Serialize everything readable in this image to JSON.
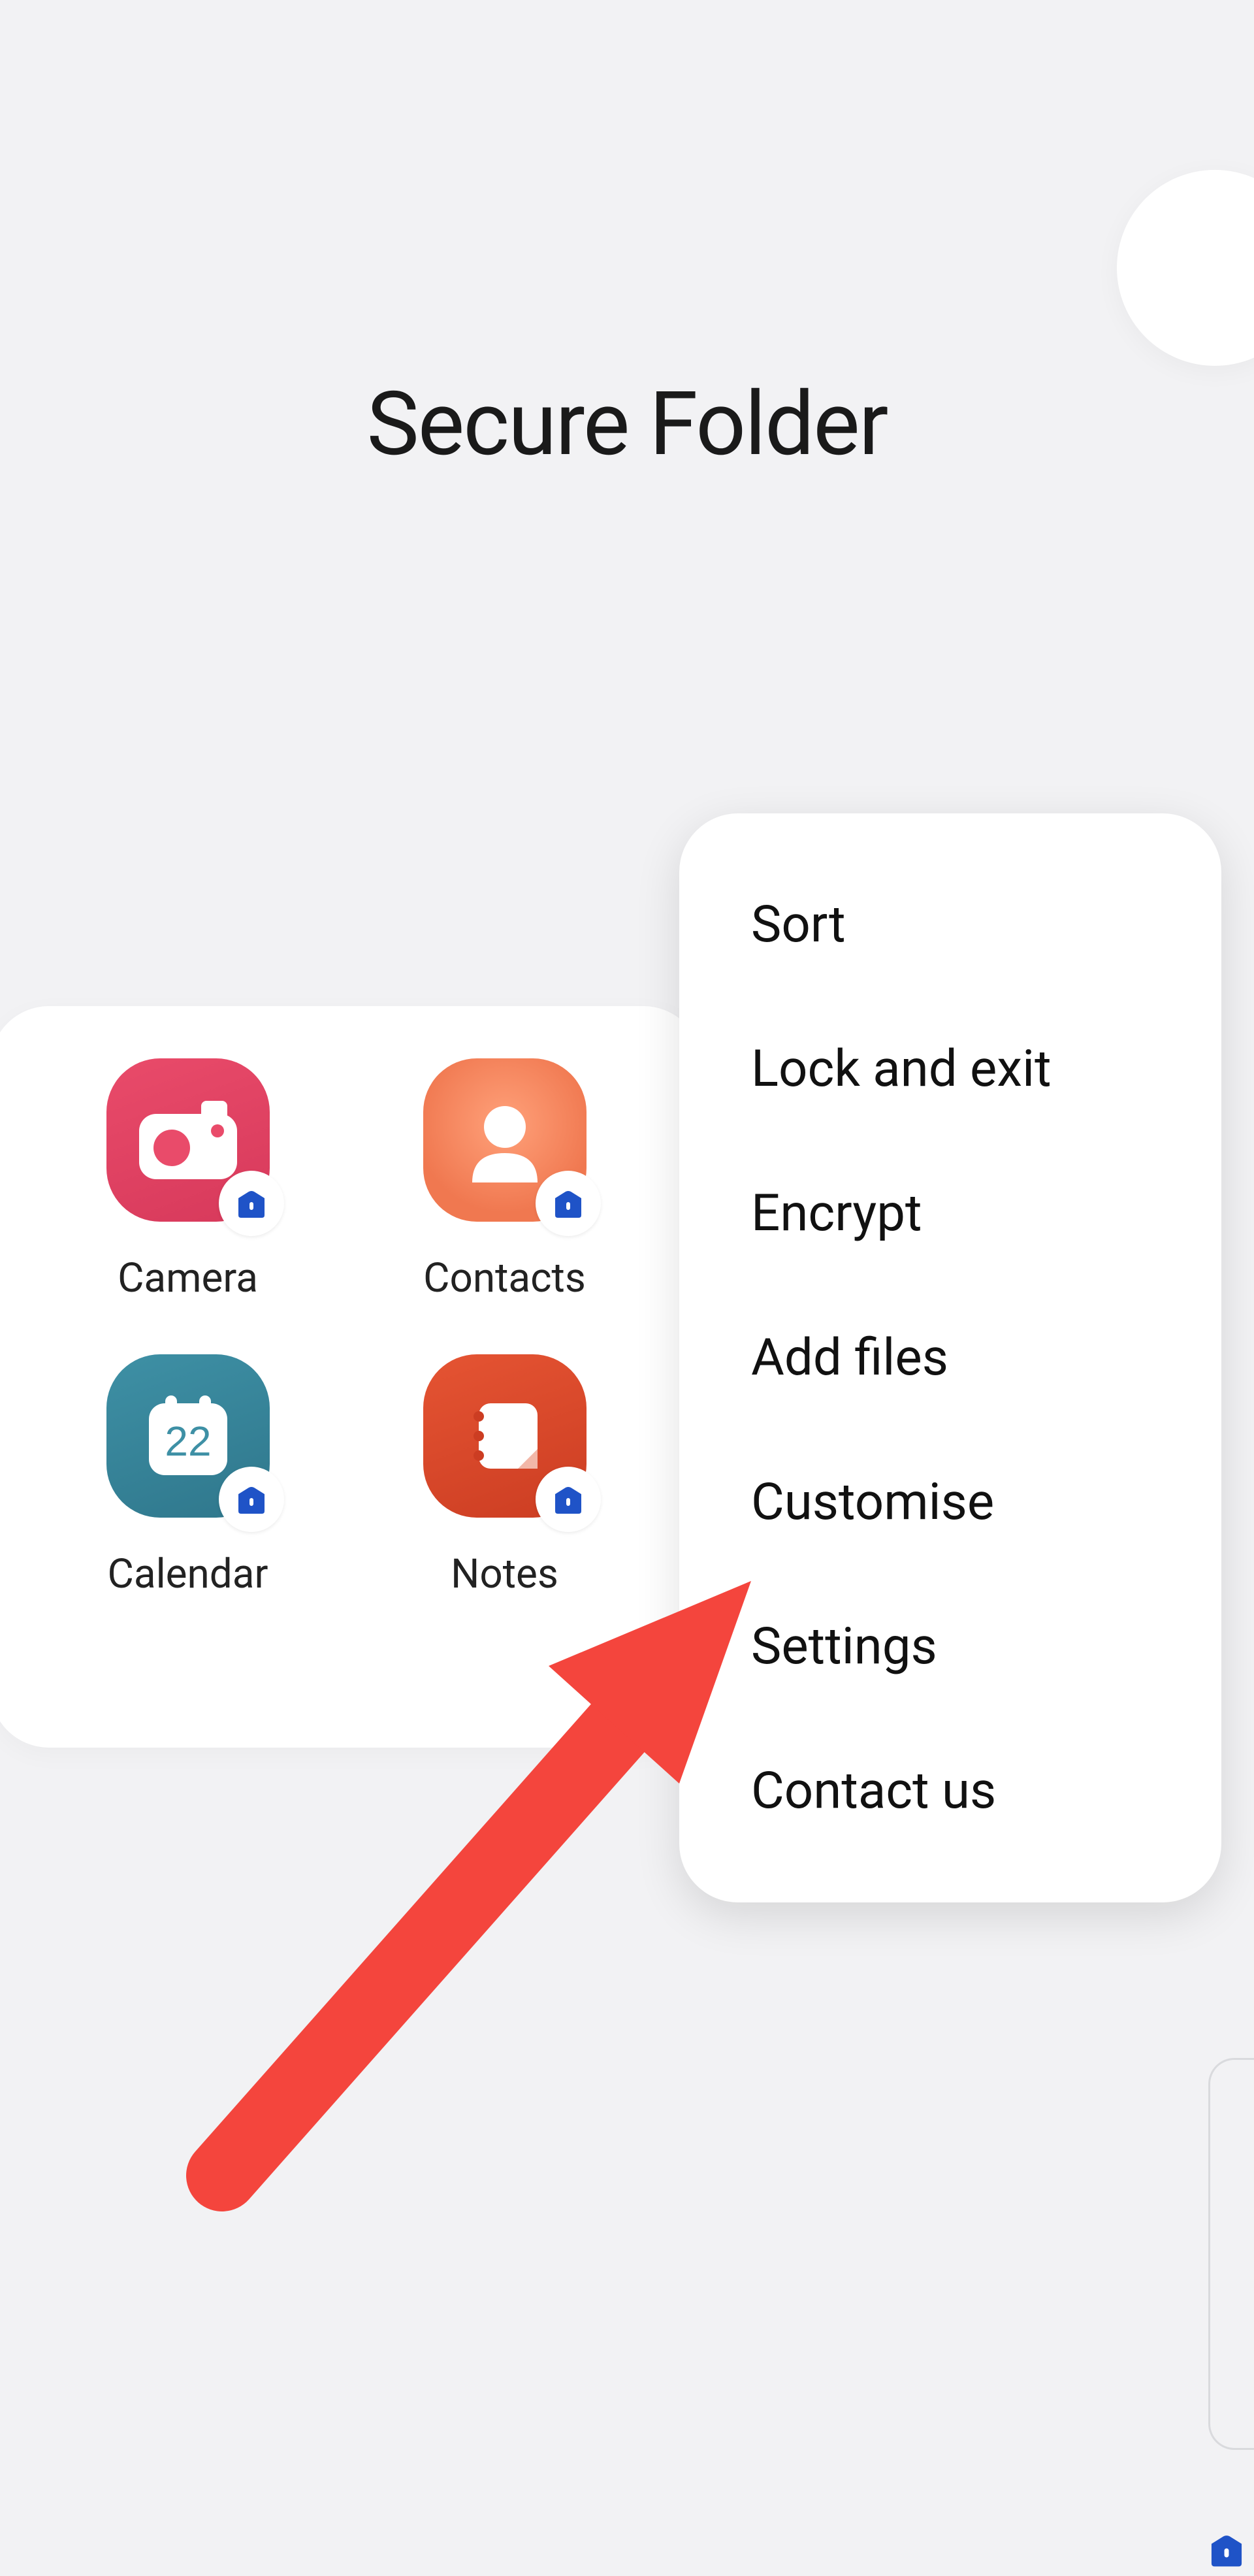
{
  "title": "Secure Folder",
  "apps": [
    {
      "label": "Camera",
      "icon": "camera-icon"
    },
    {
      "label": "Contacts",
      "icon": "contacts-icon"
    },
    {
      "label": "Calendar",
      "icon": "calendar-icon",
      "day": "22"
    },
    {
      "label": "Notes",
      "icon": "notes-icon"
    }
  ],
  "menu": {
    "items": [
      "Sort",
      "Lock and exit",
      "Encrypt",
      "Add files",
      "Customise",
      "Settings",
      "Contact us"
    ]
  },
  "annotation": {
    "arrow_points_to": "Settings"
  },
  "colors": {
    "arrow": "#f4453d",
    "badge_folder": "#1f53c7"
  }
}
